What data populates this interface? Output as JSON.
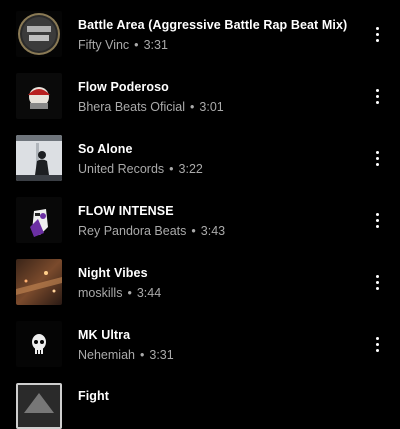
{
  "colors": {
    "background": "#000000",
    "title": "#ffffff",
    "meta": "#aaaaaa"
  },
  "separator": "•",
  "tracks": [
    {
      "title": "Battle Area (Aggressive Battle Rap Beat Mix)",
      "artist": "Fifty Vinc",
      "duration": "3:31",
      "thumb_icon": "gold-coin-logo-thumbnail"
    },
    {
      "title": "Flow Poderoso",
      "artist": "Bhera Beats Oficial",
      "duration": "3:01",
      "thumb_icon": "red-cap-character-thumbnail"
    },
    {
      "title": "So Alone",
      "artist": "United Records",
      "duration": "3:22",
      "thumb_icon": "silhouette-window-thumbnail"
    },
    {
      "title": "FLOW INTENSE",
      "artist": "Rey Pandora Beats",
      "duration": "3:43",
      "thumb_icon": "purple-character-thumbnail"
    },
    {
      "title": "Night Vibes",
      "artist": "moskills",
      "duration": "3:44",
      "thumb_icon": "night-city-lights-thumbnail"
    },
    {
      "title": "MK Ultra",
      "artist": "Nehemiah",
      "duration": "3:31",
      "thumb_icon": "skull-thumbnail"
    },
    {
      "title": "Fight",
      "artist": "",
      "duration": "",
      "thumb_icon": "dark-cover-thumbnail"
    }
  ]
}
